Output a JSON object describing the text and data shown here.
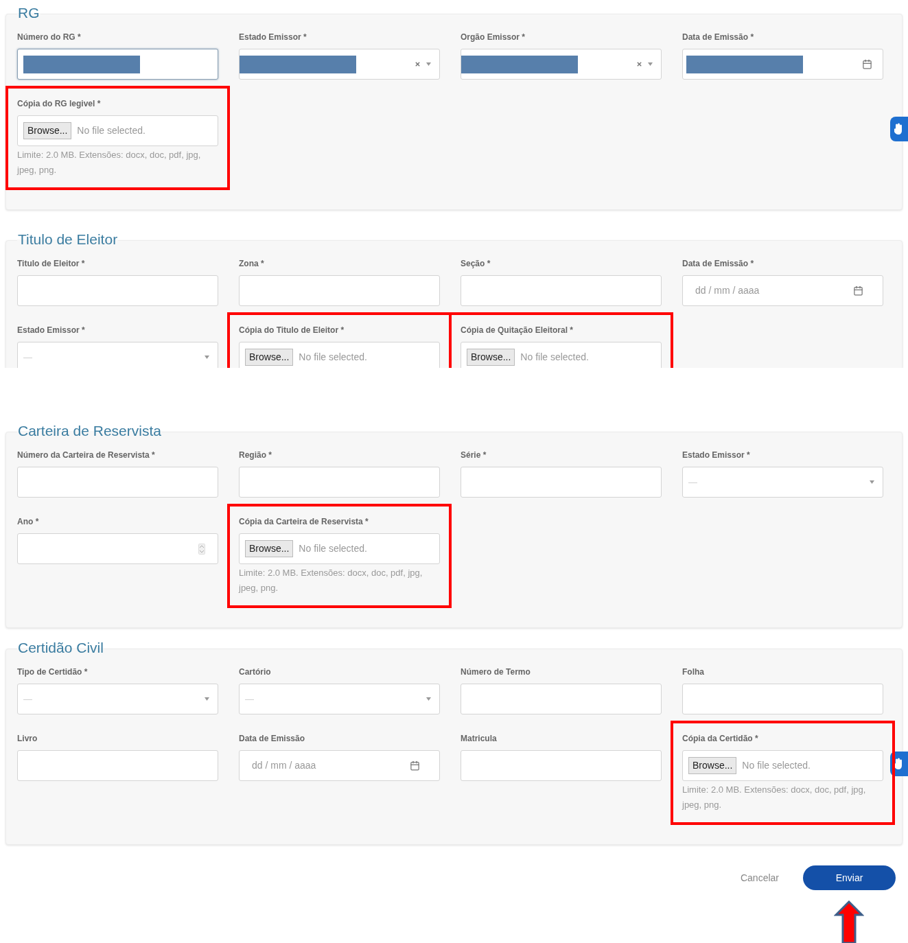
{
  "sections": [
    {
      "title": "RG",
      "cut_off": false,
      "side_button": true,
      "fields": [
        {
          "kind": "text",
          "label": "Número do RG *",
          "redacted": true,
          "focused": true,
          "highlighted": false
        },
        {
          "kind": "select",
          "label": "Estado Emissor *",
          "redacted": true,
          "clearable": true,
          "highlighted": false
        },
        {
          "kind": "select",
          "label": "Orgão Emissor *",
          "redacted": true,
          "clearable": true,
          "highlighted": false
        },
        {
          "kind": "date",
          "label": "Data de Emissão *",
          "redacted": true,
          "highlighted": false
        },
        {
          "kind": "file",
          "label": "Cópia do RG legivel *",
          "button": "Browse...",
          "status": "No file selected.",
          "hint": "Limite: 2.0 MB. Extensões: docx, doc, pdf, jpg, jpeg, png.",
          "highlighted": true
        }
      ]
    },
    {
      "title": "Titulo de Eleitor",
      "cut_off": true,
      "side_button": false,
      "fields": [
        {
          "kind": "text",
          "label": "Titulo de Eleitor *",
          "highlighted": false
        },
        {
          "kind": "text",
          "label": "Zona *",
          "highlighted": false
        },
        {
          "kind": "text",
          "label": "Seção *",
          "highlighted": false
        },
        {
          "kind": "date",
          "label": "Data de Emissão *",
          "placeholder": "dd / mm / aaaa",
          "highlighted": false
        },
        {
          "kind": "select",
          "label": "Estado Emissor *",
          "placeholder": "—",
          "highlighted": false
        },
        {
          "kind": "file",
          "label": "Cópia do Titulo de Eleitor *",
          "button": "Browse...",
          "status": "No file selected.",
          "highlighted": true
        },
        {
          "kind": "file",
          "label": "Cópia de Quitação Eleitoral *",
          "button": "Browse...",
          "status": "No file selected.",
          "highlighted": true
        }
      ]
    },
    {
      "title": "Carteira de Reservista",
      "cut_off": false,
      "side_button": false,
      "fields": [
        {
          "kind": "text",
          "label": "Número da Carteira de Reservista *",
          "highlighted": false
        },
        {
          "kind": "text",
          "label": "Região *",
          "highlighted": false
        },
        {
          "kind": "text",
          "label": "Série *",
          "highlighted": false
        },
        {
          "kind": "select",
          "label": "Estado Emissor *",
          "placeholder": "—",
          "highlighted": false
        },
        {
          "kind": "number",
          "label": "Ano *",
          "highlighted": false
        },
        {
          "kind": "file",
          "label": "Cópia da Carteira de Reservista *",
          "button": "Browse...",
          "status": "No file selected.",
          "hint": "Limite: 2.0 MB. Extensões: docx, doc, pdf, jpg, jpeg, png.",
          "highlighted": true
        }
      ]
    },
    {
      "title": "Certidão Civil",
      "cut_off": false,
      "side_button": true,
      "fields": [
        {
          "kind": "select",
          "label": "Tipo de Certidão *",
          "placeholder": "—",
          "highlighted": false
        },
        {
          "kind": "select",
          "label": "Cartório",
          "placeholder": "—",
          "highlighted": false
        },
        {
          "kind": "text",
          "label": "Número de Termo",
          "highlighted": false
        },
        {
          "kind": "text",
          "label": "Folha",
          "highlighted": false
        },
        {
          "kind": "text",
          "label": "Livro",
          "highlighted": false
        },
        {
          "kind": "date",
          "label": "Data de Emissão",
          "placeholder": "dd / mm / aaaa",
          "highlighted": false
        },
        {
          "kind": "text",
          "label": "Matricula",
          "highlighted": false
        },
        {
          "kind": "file",
          "label": "Cópia da Certidão *",
          "button": "Browse...",
          "status": "No file selected.",
          "hint": "Limite: 2.0 MB. Extensões: docx, doc, pdf, jpg, jpeg, png.",
          "highlighted": true
        }
      ]
    }
  ],
  "actions": {
    "cancel": "Cancelar",
    "submit": "Enviar"
  }
}
